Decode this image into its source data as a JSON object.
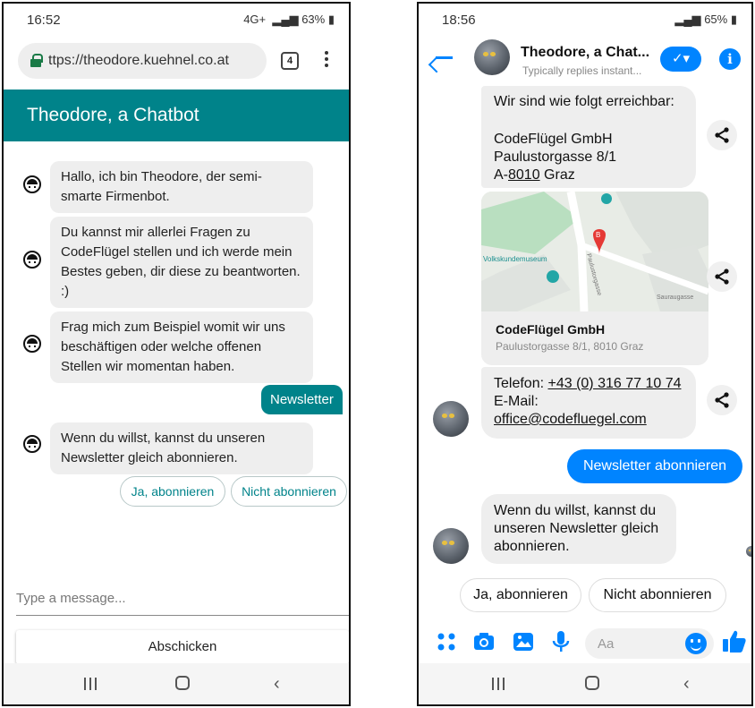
{
  "left_phone": {
    "status": {
      "time": "16:52",
      "battery": "63%",
      "network": "4G+"
    },
    "browser": {
      "url": "ttps://theodore.kuehnel.co.at",
      "tab_count": "4"
    },
    "header_title": "Theodore, a Chatbot",
    "messages": [
      {
        "from": "bot",
        "text": "Hallo, ich bin Theodore, der semi-smarte Firmenbot."
      },
      {
        "from": "bot",
        "text": "Du kannst mir allerlei Fragen zu CodeFlügel stellen und ich werde mein Bestes geben, dir diese zu beantworten. :)"
      },
      {
        "from": "bot",
        "text": "Frag mich zum Beispiel womit wir uns beschäftigen oder welche offenen Stellen wir momentan haben."
      },
      {
        "from": "user",
        "text": "Newsletter"
      },
      {
        "from": "bot",
        "text": "Wenn du willst, kannst du unseren Newsletter gleich abonnieren."
      }
    ],
    "quick_replies": [
      "Ja, abonnieren",
      "Nicht abonnieren"
    ],
    "input_placeholder": "Type a message...",
    "send_label": "Abschicken"
  },
  "right_phone": {
    "status": {
      "time": "18:56",
      "battery": "65%"
    },
    "chat_title": "Theodore, a Chat...",
    "chat_subtitle": "Typically replies instant...",
    "contact_bubble": {
      "line1": "Wir sind wie folgt erreichbar:",
      "company": "CodeFlügel GmbH",
      "street": "Paulustorgasse 8/1",
      "city_prefix": "A-",
      "postcode": "8010",
      "city": " Graz"
    },
    "map_card": {
      "poi_label": "Volkskundemuseum",
      "street_label_1": "Paulustorgasse",
      "street_label_2": "Sauraugasse",
      "pin_letter": "B",
      "business_name": "CodeFlügel GmbH",
      "business_address": "Paulustorgasse 8/1, 8010 Graz"
    },
    "phone_bubble": {
      "phone_label": "Telefon: ",
      "phone": "+43 (0) 316 77 10 74",
      "email_label": "E-Mail:",
      "email": "office@codefluegel.com"
    },
    "user_message": "Newsletter abonnieren",
    "bot_reply": "Wenn du willst, kannst du unseren Newsletter gleich abonnieren.",
    "quick_replies": [
      "Ja, abonnieren",
      "Nicht abonnieren"
    ],
    "composer_placeholder": "Aa"
  },
  "colors": {
    "teal": "#00838a",
    "messenger_blue": "#0084ff",
    "bubble_grey": "#eeeeee"
  }
}
